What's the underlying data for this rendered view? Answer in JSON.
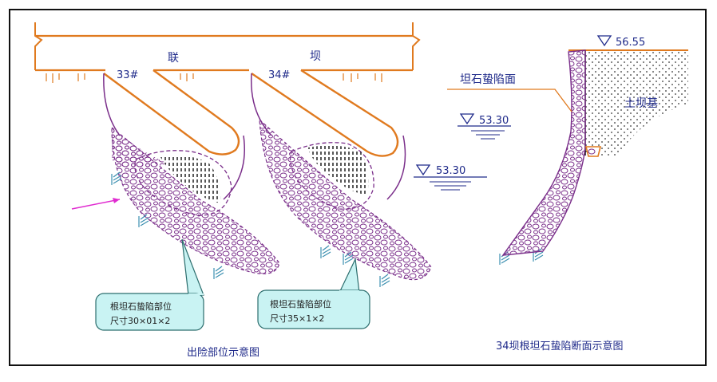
{
  "labels": {
    "dam_char_1": "联",
    "dam_char_2": "坝",
    "dam_33": "33#",
    "dam_34": "34#",
    "level_56": "56.55",
    "level_53a": "53.30",
    "level_53b": "53.30",
    "collapse_face": "坦石蛰陷面",
    "earth_core": "土坝基"
  },
  "callouts": [
    {
      "line1": "根坦石蛰陷部位",
      "line2": "尺寸30×01×2"
    },
    {
      "line1": "根坦石蛰陷部位",
      "line2": "尺寸35×1×2"
    }
  ],
  "captions": {
    "left": "出险部位示意图",
    "right": "34坝根坦石蛰陷断面示意图"
  },
  "colors": {
    "structure": "#e07a1f",
    "stone": "#7a2e8a",
    "water": "#3b8fb0",
    "text": "#1f2a8a",
    "callout_fill": "#c9f3f3",
    "arrow": "#e02ad0"
  }
}
